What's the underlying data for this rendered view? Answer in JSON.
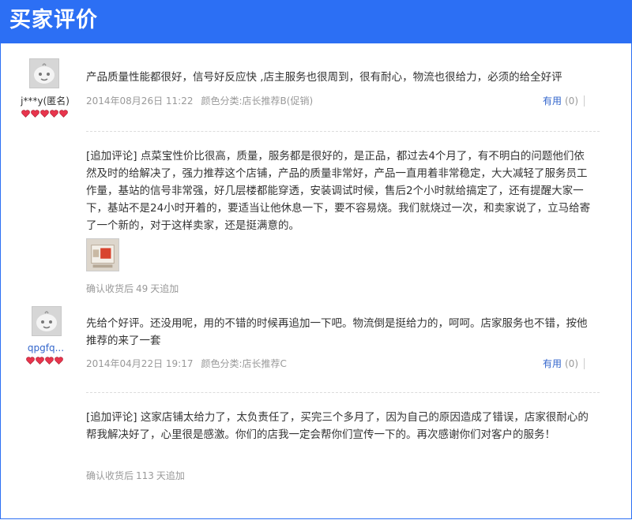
{
  "header": {
    "title": "买家评价"
  },
  "reviews": [
    {
      "user": "j***y(匿名)",
      "content": "产品质量性能都很好，信号好反应快 ,店主服务也很周到，很有耐心，物流也很给力，必须的给全好评",
      "date": "2014年08月26日 11:22",
      "sku": "颜色分类:店长推荐B(促销)",
      "useful_label": "有用",
      "useful_count": "(0)",
      "followup": {
        "content": "[追加评论] 点菜宝性价比很高，质量，服务都是很好的，是正品，都过去4个月了，有不明白的问题他们依然及时的给解决了，强力推荐这个店铺，产品的质量非常好，产品一直用着非常稳定，大大减轻了服务员工作量，基站的信号非常强，好几层楼都能穿透，安装调试时候，售后2个小时就给搞定了，还有提醒大家一下，基站不是24小时开着的，要适当让他休息一下，要不容易烧。我们就烧过一次，和卖家说了，立马给寄了一个新的，对于这样卖家，还是挺满意的。",
        "after_prefix": "确认收货后",
        "after_days": "49",
        "after_suffix": "天追加"
      }
    },
    {
      "user": "qpgfq...",
      "content": "先给个好评。还没用呢，用的不错的时候再追加一下吧。物流倒是挺给力的，呵呵。店家服务也不错，按他推荐的来了一套",
      "date": "2014年04月22日 19:17",
      "sku": "颜色分类:店长推荐C",
      "useful_label": "有用",
      "useful_count": "(0)",
      "followup": {
        "content": "[追加评论] 这家店铺太给力了，太负责任了，买完三个多月了，因为自己的原因造成了错误，店家很耐心的帮我解决好了，心里很是感激。你们的店我一定会帮你们宣传一下的。再次感谢你们对客户的服务！",
        "after_prefix": "确认收货后",
        "after_days": "113",
        "after_suffix": "天追加"
      }
    }
  ],
  "colors": {
    "header_bg": "#2c6ff4",
    "link": "#3366cc",
    "meta": "#999999",
    "heart": "#e8354d"
  },
  "icons": {
    "avatar": "default-avatar-icon",
    "rating": "heart-icon",
    "thumbnail": "review-photo-thumbnail"
  }
}
